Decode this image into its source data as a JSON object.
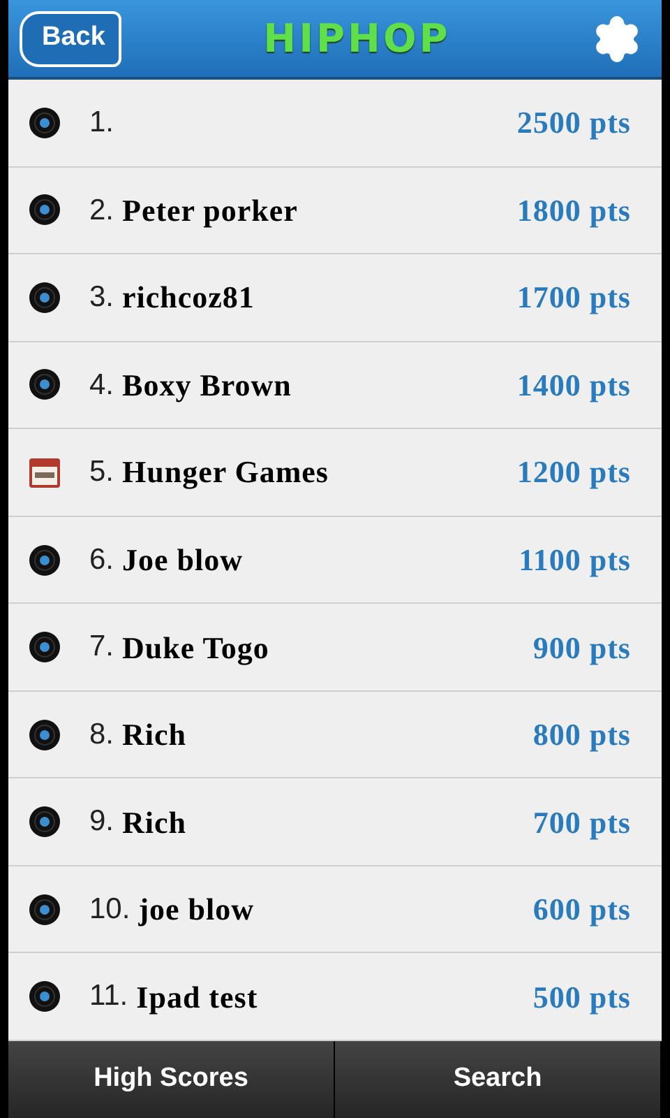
{
  "header": {
    "back": "Back",
    "title": "HIPHOP"
  },
  "scores": [
    {
      "kind": "record",
      "rank": "1.",
      "points": "2500 pts"
    },
    {
      "kind": "record",
      "rank": "2.",
      "name": "Peter porker",
      "points": "1800 pts"
    },
    {
      "kind": "record",
      "rank": "3.",
      "name": "richcoz81",
      "points": "1700 pts"
    },
    {
      "kind": "record",
      "rank": "4.",
      "name": "Boxy Brown",
      "points": "1400 pts"
    },
    {
      "kind": "calendar",
      "rank": "5.",
      "name": "Hunger Games",
      "points": "1200 pts"
    },
    {
      "kind": "record",
      "rank": "6.",
      "name": "Joe blow",
      "points": "1100 pts"
    },
    {
      "kind": "record",
      "rank": "7.",
      "name": "Duke Togo",
      "points": "900 pts"
    },
    {
      "kind": "record",
      "rank": "8.",
      "name": "Rich",
      "points": "800 pts"
    },
    {
      "kind": "record",
      "rank": "9.",
      "name": "Rich",
      "points": "700 pts"
    },
    {
      "kind": "record",
      "rank": "10.",
      "name": "joe blow",
      "points": "600 pts"
    },
    {
      "kind": "record",
      "rank": "11.",
      "name": "Ipad test",
      "points": "500 pts"
    }
  ],
  "tabs": [
    {
      "label": "High Scores",
      "selected": false
    },
    {
      "label": "Search",
      "selected": false
    }
  ]
}
